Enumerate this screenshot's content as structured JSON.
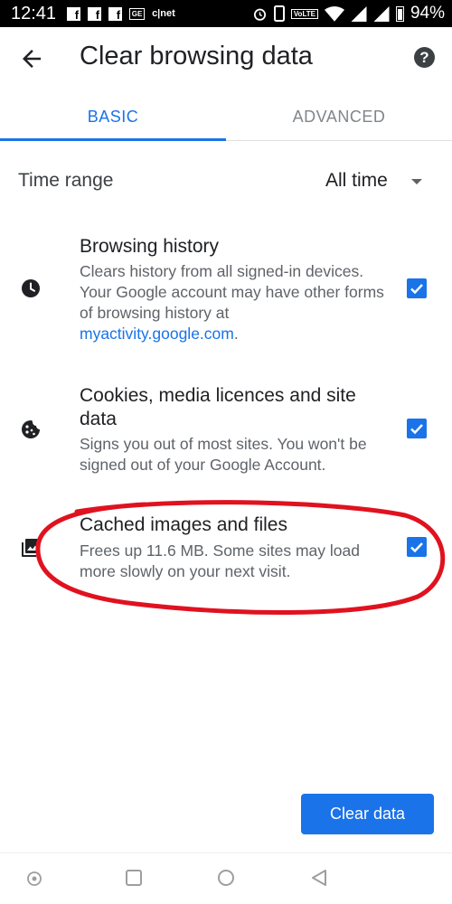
{
  "status_bar": {
    "time": "12:41",
    "notification_icons": [
      "facebook-icon",
      "facebook-icon",
      "facebook-icon",
      "ge-icon",
      "cnet-icon"
    ],
    "ge_label": "GE",
    "cnet_label": "c|net",
    "volte_label": "VoLTE",
    "battery_percent": "94%"
  },
  "app_bar": {
    "title": "Clear browsing data",
    "back_icon": "arrow-back-icon",
    "help_icon": "help-icon",
    "help_glyph": "?"
  },
  "tabs": [
    {
      "label": "BASIC",
      "selected": true
    },
    {
      "label": "ADVANCED",
      "selected": false
    }
  ],
  "time_range": {
    "label": "Time range",
    "value": "All time"
  },
  "items": [
    {
      "title": "Browsing history",
      "description_prefix": "Clears history from all signed-in devices. Your Google account may have other forms of browsing history at ",
      "link": "myactivity.google.com",
      "description_suffix": ".",
      "icon": "clock-icon",
      "checked": true
    },
    {
      "title": "Cookies, media licences and site data",
      "description": "Signs you out of most sites. You won't be signed out of your Google Account.",
      "icon": "cookie-icon",
      "checked": true
    },
    {
      "title": "Cached images and files",
      "description": "Frees up 11.6 MB. Some sites may load more slowly on your next visit.",
      "icon": "image-icon",
      "checked": true
    }
  ],
  "clear_button": {
    "label": "Clear data"
  },
  "colors": {
    "accent": "#1a73e8",
    "annotation": "#e0121f"
  }
}
